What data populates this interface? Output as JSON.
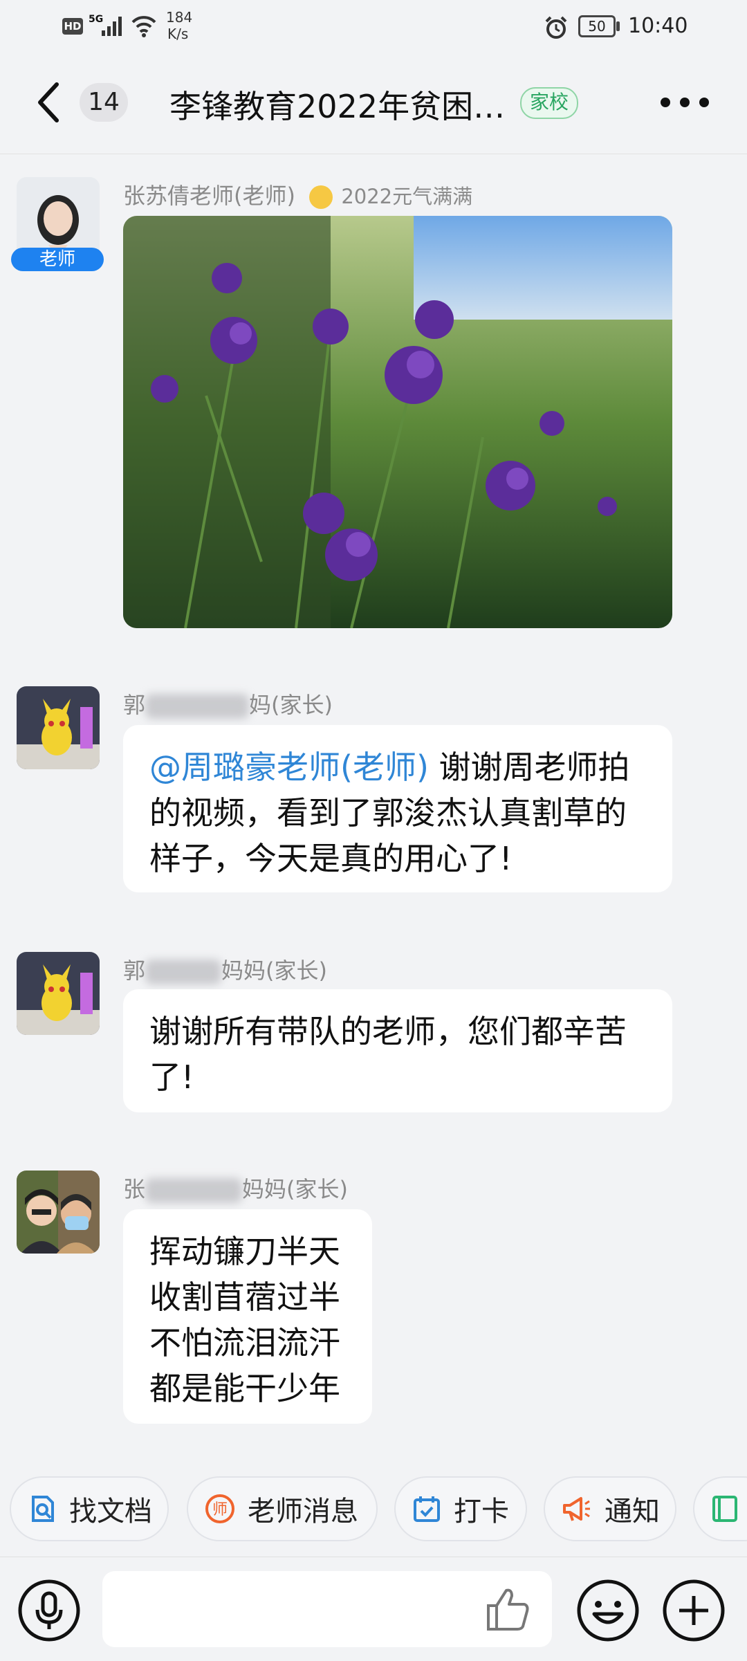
{
  "status_bar": {
    "hd": "HD",
    "net": "5G",
    "speed_value": "184",
    "speed_unit": "K/s",
    "battery": "50",
    "time": "10:40"
  },
  "header": {
    "unread_count": "14",
    "title": "李锋教育2022年贫困…",
    "tag": "家校"
  },
  "messages": [
    {
      "sender": "张苏倩老师(老师)",
      "sender_badge": "2022元气满满",
      "role_label": "老师",
      "type": "image"
    },
    {
      "sender_prefix": "郭",
      "sender_suffix": "妈(家长)",
      "mention": "@周璐豪老师(老师)",
      "lines": [
        "谢谢周老师拍",
        "的视频，看到了郭浚杰认真割草的",
        "样子，今天是真的用心了!"
      ]
    },
    {
      "sender_prefix": "郭",
      "sender_suffix": "妈妈(家长)",
      "lines": [
        "谢谢所有带队的老师，您们都辛苦",
        "了!"
      ]
    },
    {
      "sender_prefix": "张",
      "sender_suffix": "妈妈(家长)",
      "lines": [
        "挥动镰刀半天",
        "收割苜蓿过半",
        "不怕流泪流汗",
        "都是能干少年"
      ]
    }
  ],
  "quick_actions": [
    {
      "label": "找文档",
      "icon": "doc-search-icon",
      "color": "#2f86d6"
    },
    {
      "label": "老师消息",
      "icon": "teacher-icon",
      "color": "#f0642d"
    },
    {
      "label": "打卡",
      "icon": "checkin-calendar-icon",
      "color": "#2f86d6"
    },
    {
      "label": "通知",
      "icon": "megaphone-icon",
      "color": "#f0642d"
    }
  ]
}
